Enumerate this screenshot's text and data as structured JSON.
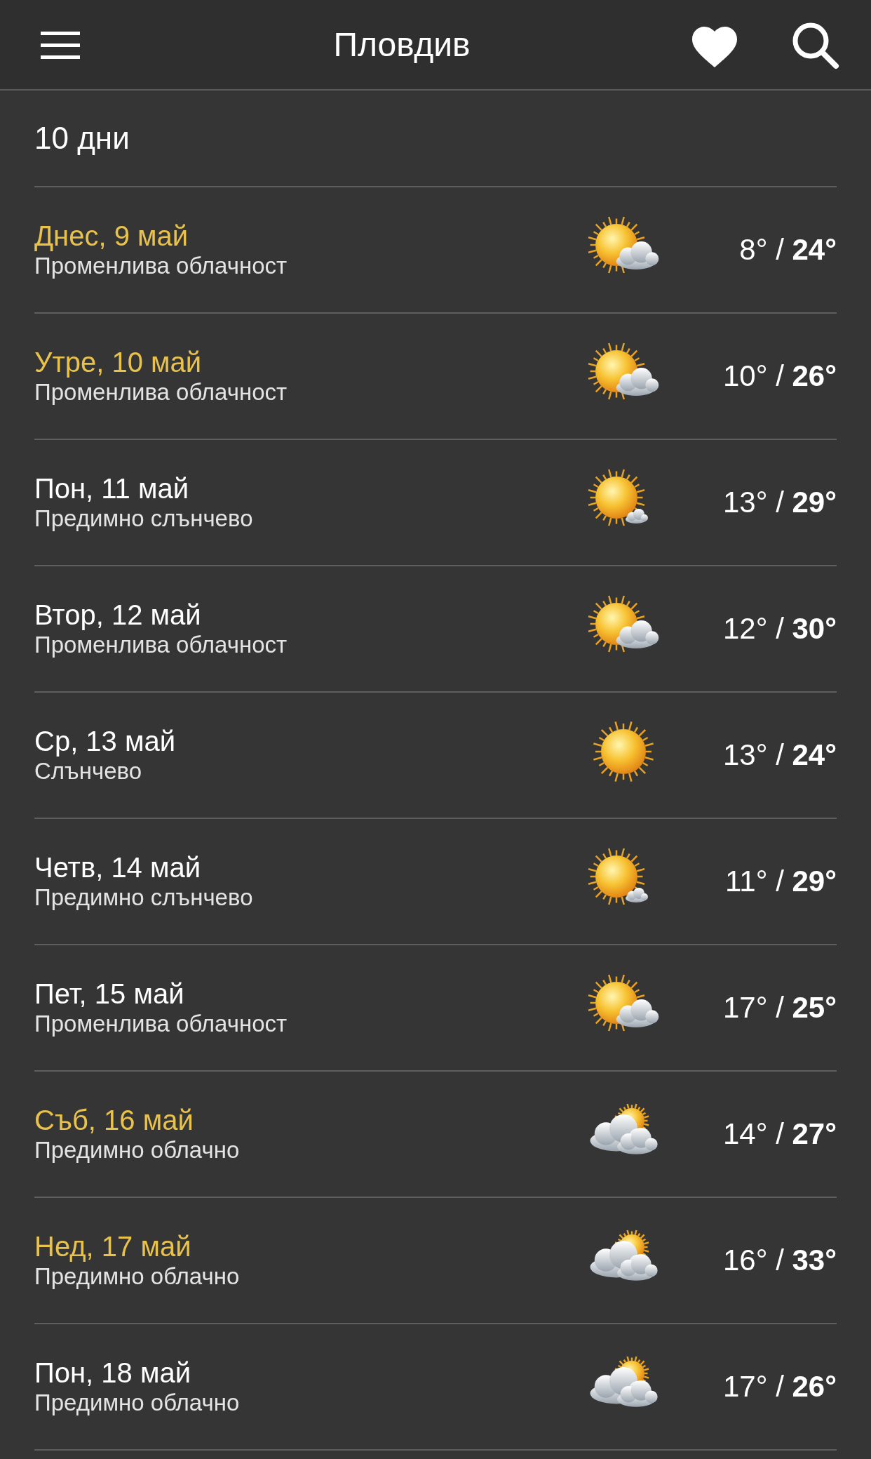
{
  "header": {
    "title": "Пловдив"
  },
  "section": {
    "title": "10 дни"
  },
  "days": [
    {
      "date": "Днес, 9 май",
      "highlighted": true,
      "condition": "Променлива облачност",
      "kind": "partly-cloudy",
      "temp": "8° / **24°**"
    },
    {
      "date": "Утре, 10 май",
      "highlighted": true,
      "condition": "Променлива облачност",
      "kind": "partly-cloudy",
      "temp": "10° / **26°**"
    },
    {
      "date": "Пон, 11 май",
      "highlighted": false,
      "condition": "Предимно слънчево",
      "kind": "mostly-sunny",
      "temp": "13° / **29°**"
    },
    {
      "date": "Втор, 12 май",
      "highlighted": false,
      "condition": "Променлива облачност",
      "kind": "partly-cloudy",
      "temp": "12° / **30°**"
    },
    {
      "date": "Ср, 13 май",
      "highlighted": false,
      "condition": "Слънчево",
      "kind": "sunny",
      "temp": "13° / **24°**"
    },
    {
      "date": "Четв, 14 май",
      "highlighted": false,
      "condition": "Предимно слънчево",
      "kind": "mostly-sunny",
      "temp": "11° / **29°**"
    },
    {
      "date": "Пет, 15 май",
      "highlighted": false,
      "condition": "Променлива облачност",
      "kind": "partly-cloudy",
      "temp": "17° / **25°**"
    },
    {
      "date": "Съб, 16 май",
      "highlighted": true,
      "condition": "Предимно облачно",
      "kind": "mostly-cloudy",
      "temp": "14° / **27°**"
    },
    {
      "date": "Нед, 17 май",
      "highlighted": true,
      "condition": "Предимно облачно",
      "kind": "mostly-cloudy",
      "temp": "16° / **33°**"
    },
    {
      "date": "Пон, 18 май",
      "highlighted": false,
      "condition": "Предимно облачно",
      "kind": "mostly-cloudy",
      "temp": "17° / **26°**"
    }
  ]
}
